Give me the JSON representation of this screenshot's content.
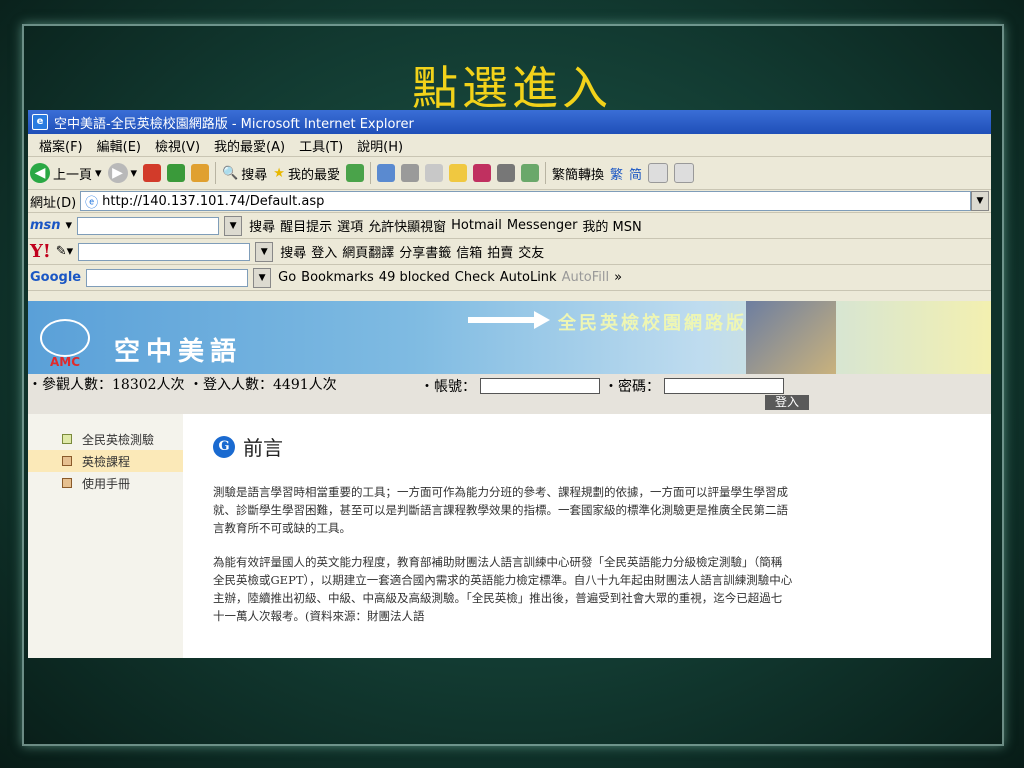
{
  "slide": {
    "title": "點選進入"
  },
  "window": {
    "title": "空中美語-全民英檢校園網路版 - Microsoft Internet Explorer"
  },
  "menu": [
    "檔案(F)",
    "編輯(E)",
    "檢視(V)",
    "我的最愛(A)",
    "工具(T)",
    "說明(H)"
  ],
  "toolbar": {
    "back": "上一頁",
    "search": "搜尋",
    "favorites": "我的最愛",
    "convert": "繁簡轉換",
    "trad": "繁",
    "simp": "简"
  },
  "address": {
    "label": "網址(D)",
    "url": "http://140.137.101.74/Default.asp"
  },
  "msn_bar": {
    "logo": "msn",
    "search": "搜尋",
    "highlight": "醒目提示",
    "options": "選項",
    "popup": "允許快顯視窗",
    "hotmail": "Hotmail",
    "messenger": "Messenger",
    "my_msn": "我的 MSN"
  },
  "yahoo_bar": {
    "logo": "Y!",
    "search": "搜尋",
    "login": "登入",
    "translate": "網頁翻譯",
    "bookmarks": "分享書籤",
    "mail": "信箱",
    "auction": "拍賣",
    "friends": "交友"
  },
  "google_bar": {
    "logo": "Google",
    "go": "Go",
    "bookmarks": "Bookmarks",
    "blocked": "49 blocked",
    "check": "Check",
    "autolink": "AutoLink",
    "autofill": "AutoFill"
  },
  "site": {
    "amc": "AMC",
    "name": "空中美語",
    "banner_title": "全民英檢校園網路版",
    "stats_visits": "・參觀人數：18302人次",
    "stats_logins": "・登入人數：4491人次",
    "account_label": "・帳號：",
    "password_label": "・密碼：",
    "login_button": "登入"
  },
  "sidebar": {
    "items": [
      {
        "label": "全民英檢測驗"
      },
      {
        "label": "英檢課程"
      },
      {
        "label": "使用手冊"
      }
    ]
  },
  "content": {
    "heading": "前言",
    "para1": "測驗是語言學習時相當重要的工具；一方面可作為能力分班的參考、課程規劃的依據，一方面可以評量學生學習成就、診斷學生學習困難，甚至可以是判斷語言課程教學效果的指標。一套國家級的標準化測驗更是推廣全民第二語言教育所不可或缺的工具。",
    "para2": "為能有效評量國人的英文能力程度，教育部補助財團法人語言訓練中心研發「全民英語能力分級檢定測驗」（簡稱全民英檢或GEPT），以期建立一套適合國內需求的英語能力檢定標準。自八十九年起由財團法人語言訓練測驗中心主辦，陸續推出初級、中級、中高級及高級測驗。「全民英檢」推出後，普遍受到社會大眾的重視，迄今已超過七十一萬人次報考。(資料來源：財團法人語"
  },
  "colors": {
    "slide_title": "#f2d21a",
    "titlebar": "#1f4fb8"
  }
}
